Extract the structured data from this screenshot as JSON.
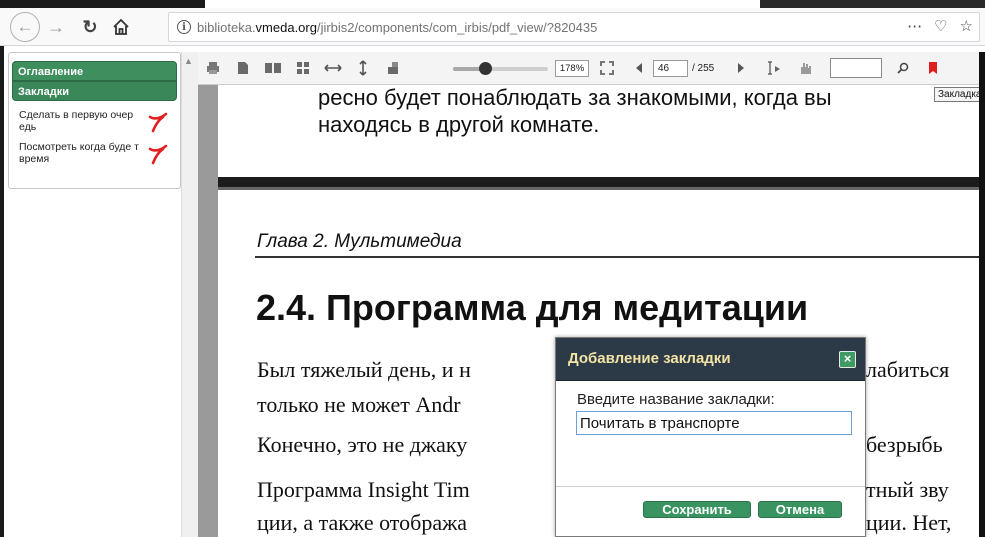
{
  "browser": {
    "url_prefix": "biblioteka.",
    "url_domain": "vmeda.org",
    "url_path": "/jirbis2/components/com_irbis/pdf_view/?820435",
    "actions": [
      "⋯",
      "♡",
      "☆"
    ]
  },
  "sidebar": {
    "tab_contents": "Оглавление",
    "tab_bookmarks": "Закладки",
    "bookmarks": [
      {
        "label": "Сделать в первую очер едь"
      },
      {
        "label": "Посмотреть когда буде т время"
      }
    ]
  },
  "toolbar": {
    "zoom_value": "178%",
    "zoom_level": 0.35,
    "current_page": "46",
    "total_pages": "/ 255",
    "search_value": "",
    "bookmark_tooltip": "Закладка"
  },
  "document": {
    "page1_line1": "ресно будет понаблюдать за знакомыми, когда вы",
    "page1_line2": "находясь в другой комнате.",
    "chapter": "Глава 2. Мультимедиа",
    "heading": "2.4. Программа для медитации",
    "lines": [
      "Был тяжелый день, и н",
      "только не может Andr",
      "Конечно, это не джаку",
      "Программа Insight Tim",
      "ции, а также отобража"
    ],
    "lines_right": [
      "лабиться",
      "",
      "безрыбь",
      "тный зву",
      "ции. Нет,"
    ]
  },
  "dialog": {
    "title": "Добавление закладки",
    "label": "Введите название закладки:",
    "input_value": "Почитать в транспорте",
    "save_label": "Сохранить",
    "cancel_label": "Отмена"
  },
  "colors": {
    "accent_green": "#3e8e5e",
    "dialog_header": "#2c3a47",
    "dialog_title": "#f3e3a4",
    "bookmark_red": "#e02020"
  }
}
